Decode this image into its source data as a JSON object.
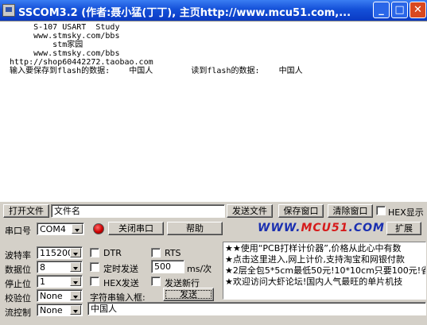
{
  "window": {
    "title": "SSCOM3.2 (作者:聂小猛(丁丁), 主页http://www.mcu51.com,..."
  },
  "receive": {
    "lines": [
      "     S-107 USART  Study",
      "     www.stmsky.com/bbs",
      "         stm家园",
      "     www.stmsky.com/bbs",
      "http://shop60442272.taobao.com",
      "输入要保存到flash的数据:    中国人        读到flash的数据:    中国人"
    ]
  },
  "file_row": {
    "open_file": "打开文件",
    "filename": "文件名",
    "send_file": "发送文件",
    "save_window": "保存窗口",
    "clear_window": "清除窗口",
    "hex_display": "HEX显示"
  },
  "port_row": {
    "port_label": "串口号",
    "port_value": "COM4",
    "close_port": "关闭串口",
    "help": "帮助",
    "brand_main": "WWW.",
    "brand_red": "MCU51",
    "brand_end": ".COM",
    "expand": "扩展"
  },
  "settings": {
    "baud_label": "波特率",
    "baud_value": "115200",
    "data_label": "数据位",
    "data_value": "8",
    "stop_label": "停止位",
    "stop_value": "1",
    "parity_label": "校验位",
    "parity_value": "None",
    "flow_label": "流控制",
    "flow_value": "None"
  },
  "options": {
    "dtr": "DTR",
    "rts": "RTS",
    "timed_send": "定时发送",
    "interval": "500",
    "interval_unit": "ms/次",
    "hex_send": "HEX发送",
    "send_newline": "发送新行",
    "string_input_label": "字符串输入框:",
    "send_button": "发送"
  },
  "ads": [
    "★★使用“PCB打样计价器”,价格从此心中有数",
    "★点击这里进入,网上计价,支持淘宝和网银付款",
    "★2层全包5*5cm最低50元!10*10cm只要100元!省",
    "★欢迎访问大虾论坛!国内人气最旺的单片机技"
  ],
  "input": {
    "value": "中国人"
  }
}
